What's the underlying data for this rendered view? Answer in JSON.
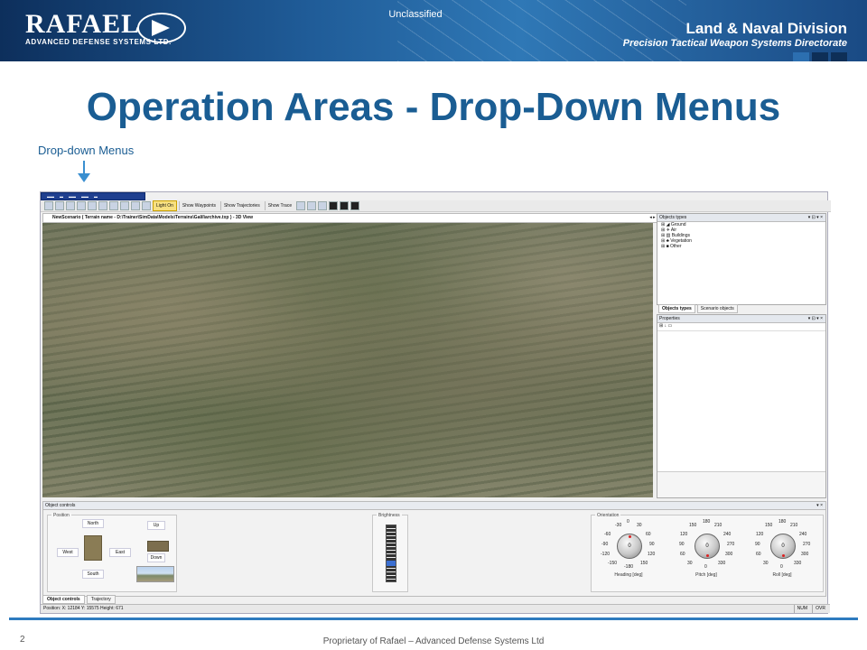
{
  "banner": {
    "logo_word": "RAFAEL",
    "logo_sub": "ADVANCED DEFENSE SYSTEMS LTD.",
    "classification": "Unclassified",
    "division_line1": "Land & Naval Division",
    "division_line2": "Precision Tactical Weapon Systems Directorate"
  },
  "slide": {
    "title": "Operation Areas - Drop-Down Menus",
    "annotation_label": "Drop-down Menus",
    "page_number": "2",
    "footer": "Proprietary of Rafael – Advanced Defense Systems Ltd"
  },
  "app": {
    "toolbar": {
      "light": "Light On",
      "waypoints": "Show Waypoints",
      "trajectories": "Show Trajectories",
      "trace": "Show Trace"
    },
    "view_tab": "NewScenario ( Terrain name - D:\\Trainer\\SimData\\Models\\Terrains\\Galil\\archive.txp ) - 3D View",
    "objects_panel": {
      "title": "Objects types",
      "items": [
        "Ground",
        "Air",
        "Buildings",
        "Vegetation",
        "Other"
      ],
      "tabs": [
        "Objects types",
        "Scenario objects"
      ]
    },
    "properties_panel": {
      "title": "Properties"
    },
    "object_controls": {
      "title": "Object controls",
      "position": {
        "label": "Position",
        "north": "North",
        "south": "South",
        "west": "West",
        "east": "East",
        "up": "Up",
        "down": "Down"
      },
      "brightness_label": "Brightness",
      "brightness_level": 0.3,
      "orientation": {
        "label": "Orientation",
        "heading": {
          "label": "Heading [deg]",
          "value": "0",
          "ticks": [
            "-30",
            "0",
            "30",
            "-60",
            "60",
            "-90",
            "90",
            "-120",
            "120",
            "-150",
            "-180",
            "150"
          ]
        },
        "pitch": {
          "label": "Pitch [deg]",
          "value": "0",
          "ticks": [
            "150",
            "180",
            "210",
            "120",
            "240",
            "90",
            "270",
            "60",
            "300",
            "30",
            "0",
            "330"
          ]
        },
        "roll": {
          "label": "Roll [deg]",
          "value": "0",
          "ticks": [
            "150",
            "180",
            "210",
            "120",
            "240",
            "90",
            "270",
            "60",
            "300",
            "30",
            "0",
            "330"
          ]
        }
      }
    },
    "bottom_tabs": [
      "Object controls",
      "Trajectory"
    ],
    "status": {
      "position": "Position: X: 12184 Y: 15575 Height: 671",
      "num": "NUM",
      "ovr": "OVR"
    }
  }
}
